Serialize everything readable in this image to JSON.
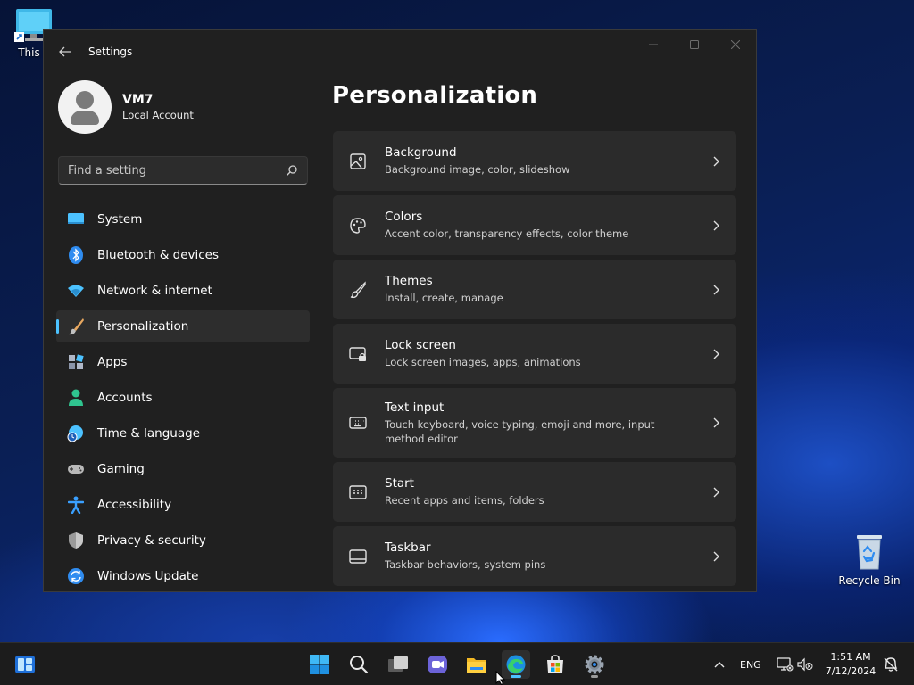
{
  "desktop": {
    "this_pc_label": "This P",
    "recycle_bin_label": "Recycle Bin"
  },
  "window": {
    "title": "Settings",
    "back_icon": "arrow-left-icon",
    "controls": [
      "minimize-icon",
      "maximize-icon",
      "close-icon"
    ]
  },
  "profile": {
    "name": "VM7",
    "account_type": "Local Account"
  },
  "search": {
    "placeholder": "Find a setting"
  },
  "nav": {
    "items": [
      {
        "label": "System",
        "icon": "system-monitor-icon",
        "color": "#4cc2ff"
      },
      {
        "label": "Bluetooth & devices",
        "icon": "bluetooth-icon",
        "color": "#2f8cf0"
      },
      {
        "label": "Network & internet",
        "icon": "wifi-icon",
        "color": "#4cc2ff"
      },
      {
        "label": "Personalization",
        "icon": "paintbrush-icon",
        "color": "#e8a860",
        "active": true
      },
      {
        "label": "Apps",
        "icon": "apps-icon",
        "color": "#b0b8c8"
      },
      {
        "label": "Accounts",
        "icon": "person-icon",
        "color": "#2fc48f"
      },
      {
        "label": "Time & language",
        "icon": "globe-clock-icon",
        "color": "#4cc2ff"
      },
      {
        "label": "Gaming",
        "icon": "gamepad-icon",
        "color": "#b8b8b8"
      },
      {
        "label": "Accessibility",
        "icon": "accessibility-icon",
        "color": "#3aa0ff"
      },
      {
        "label": "Privacy & security",
        "icon": "shield-icon",
        "color": "#9a9a9a"
      },
      {
        "label": "Windows Update",
        "icon": "update-sync-icon",
        "color": "#2f8cf0"
      }
    ]
  },
  "main": {
    "title": "Personalization",
    "cards": [
      {
        "title": "Background",
        "subtitle": "Background image, color, slideshow",
        "icon": "image-icon"
      },
      {
        "title": "Colors",
        "subtitle": "Accent color, transparency effects, color theme",
        "icon": "palette-icon"
      },
      {
        "title": "Themes",
        "subtitle": "Install, create, manage",
        "icon": "brush-icon"
      },
      {
        "title": "Lock screen",
        "subtitle": "Lock screen images, apps, animations",
        "icon": "lock-screen-icon"
      },
      {
        "title": "Text input",
        "subtitle": "Touch keyboard, voice typing, emoji and more, input method editor",
        "icon": "keyboard-icon"
      },
      {
        "title": "Start",
        "subtitle": "Recent apps and items, folders",
        "icon": "start-menu-icon"
      },
      {
        "title": "Taskbar",
        "subtitle": "Taskbar behaviors, system pins",
        "icon": "taskbar-icon"
      }
    ]
  },
  "taskbar": {
    "apps": [
      "widgets-icon",
      "windows-start-icon",
      "search-icon",
      "task-view-icon",
      "teams-chat-icon",
      "file-explorer-icon",
      "edge-browser-icon",
      "store-icon",
      "settings-gear-icon"
    ],
    "language": "ENG",
    "time": "1:51 AM",
    "date": "7/12/2024"
  }
}
